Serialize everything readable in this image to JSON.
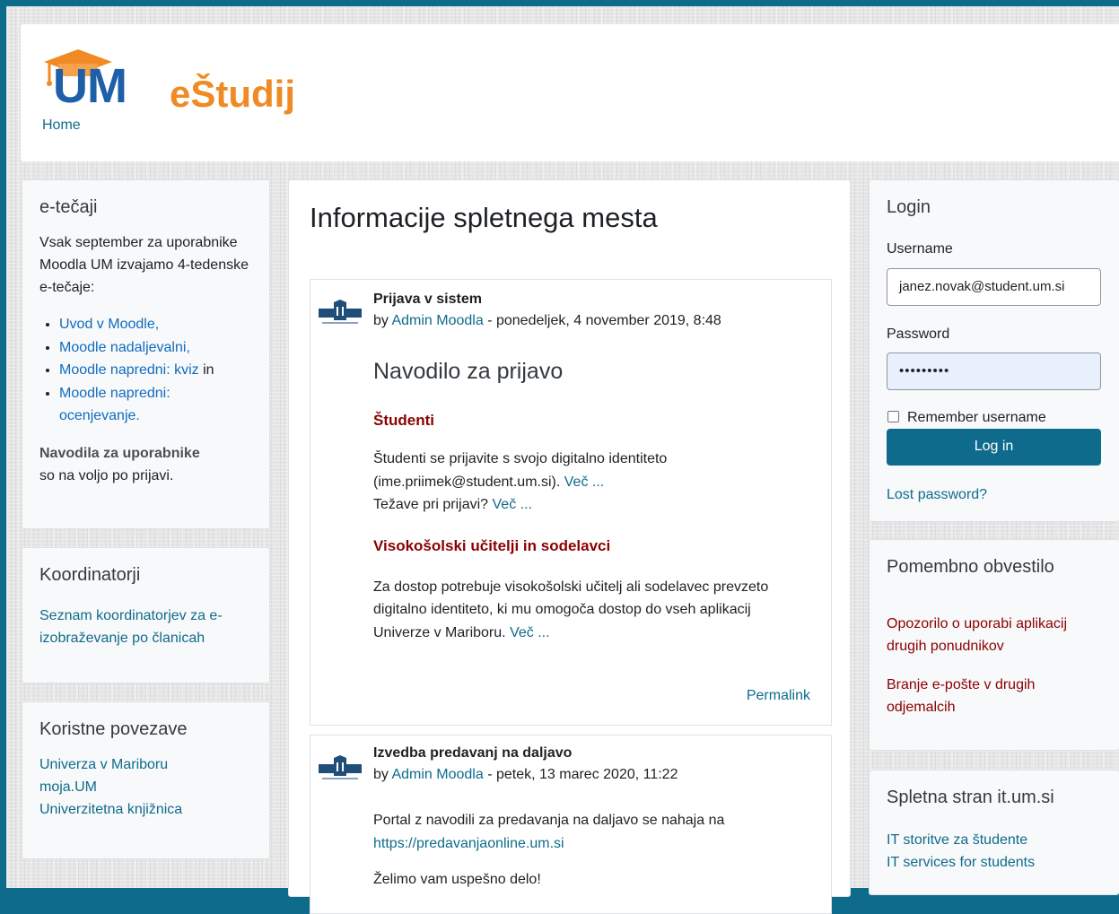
{
  "header": {
    "logo_um": "UM",
    "logo_estudij": "eŠtudij",
    "home": "Home"
  },
  "left": {
    "etecaji": {
      "title": "e-tečaji",
      "intro": "Vsak september za uporabnike Moodla UM izvajamo 4-tedenske e-tečaje:",
      "items": [
        {
          "link": "Uvod v Moodle",
          "after": ","
        },
        {
          "link": "Moodle nadaljevalni",
          "after": ","
        },
        {
          "link": "Moodle napredni: kviz",
          "after": " in"
        },
        {
          "link": "Moodle napredni: ocenjevanje",
          "after": "."
        }
      ],
      "note_bold": "Navodila za uporabnike",
      "note_rest": "so na voljo po prijavi."
    },
    "koordinatorji": {
      "title": "Koordinatorji",
      "link": "Seznam koordinatorjev za e-izobraževanje po članicah"
    },
    "povezave": {
      "title": "Koristne povezave",
      "links": [
        "Univerza v Mariboru",
        "moja.UM",
        "Univerzitetna knjižnica"
      ]
    }
  },
  "main": {
    "title": "Informacije spletnega mesta",
    "post1": {
      "title": "Prijava v sistem",
      "by": "by ",
      "author": "Admin Moodla",
      "date": " - ponedeljek, 4 november 2019, 8:48",
      "heading": "Navodilo za prijavo",
      "sec1_title": "Študenti",
      "sec1_text_a": "Študenti se prijavite s svojo digitalno identiteto (ime.priimek@student.um.si).",
      "sec1_more": "Več ...",
      "sec1_text_b": "Težave pri prijavi?",
      "sec1_more_b": "Več ...",
      "sec2_title": "Visokošolski učitelji in sodelavci",
      "sec2_text": "Za dostop potrebuje visokošolski učitelj ali sodelavec prevzeto digitalno identiteto, ki mu omogoča dostop do vseh aplikacij Univerze v Mariboru.",
      "sec2_more": "Več ...",
      "permalink": "Permalink"
    },
    "post2": {
      "title": "Izvedba predavanj na daljavo",
      "by": "by ",
      "author": "Admin Moodla",
      "date": " - petek, 13 marec 2020, 11:22",
      "text_a": "Portal z navodili za predavanja na daljavo se nahaja na",
      "url": "https://predavanjaonline.um.si",
      "text_b": "Želimo vam uspešno delo!"
    }
  },
  "right": {
    "login": {
      "title": "Login",
      "username_label": "Username",
      "username_value": "janez.novak@student.um.si",
      "password_label": "Password",
      "password_value": "•••••••••",
      "remember": "Remember username",
      "button": "Log in",
      "lost": "Lost password?"
    },
    "obvestilo": {
      "title": "Pomembno obvestilo",
      "link1": "Opozorilo o uporabi aplikacij drugih ponudnikov",
      "link2": "Branje e-pošte v drugih odjemalcih"
    },
    "itum": {
      "title": "Spletna stran it.um.si",
      "link1": "IT storitve za študente",
      "link2": "IT services for students"
    }
  },
  "colors": {
    "frame": "#0f6b8c",
    "link": "#0f6cbf",
    "accent_red": "#8b0000",
    "logo_blue": "#1f5fa8",
    "logo_orange": "#f08a24"
  }
}
